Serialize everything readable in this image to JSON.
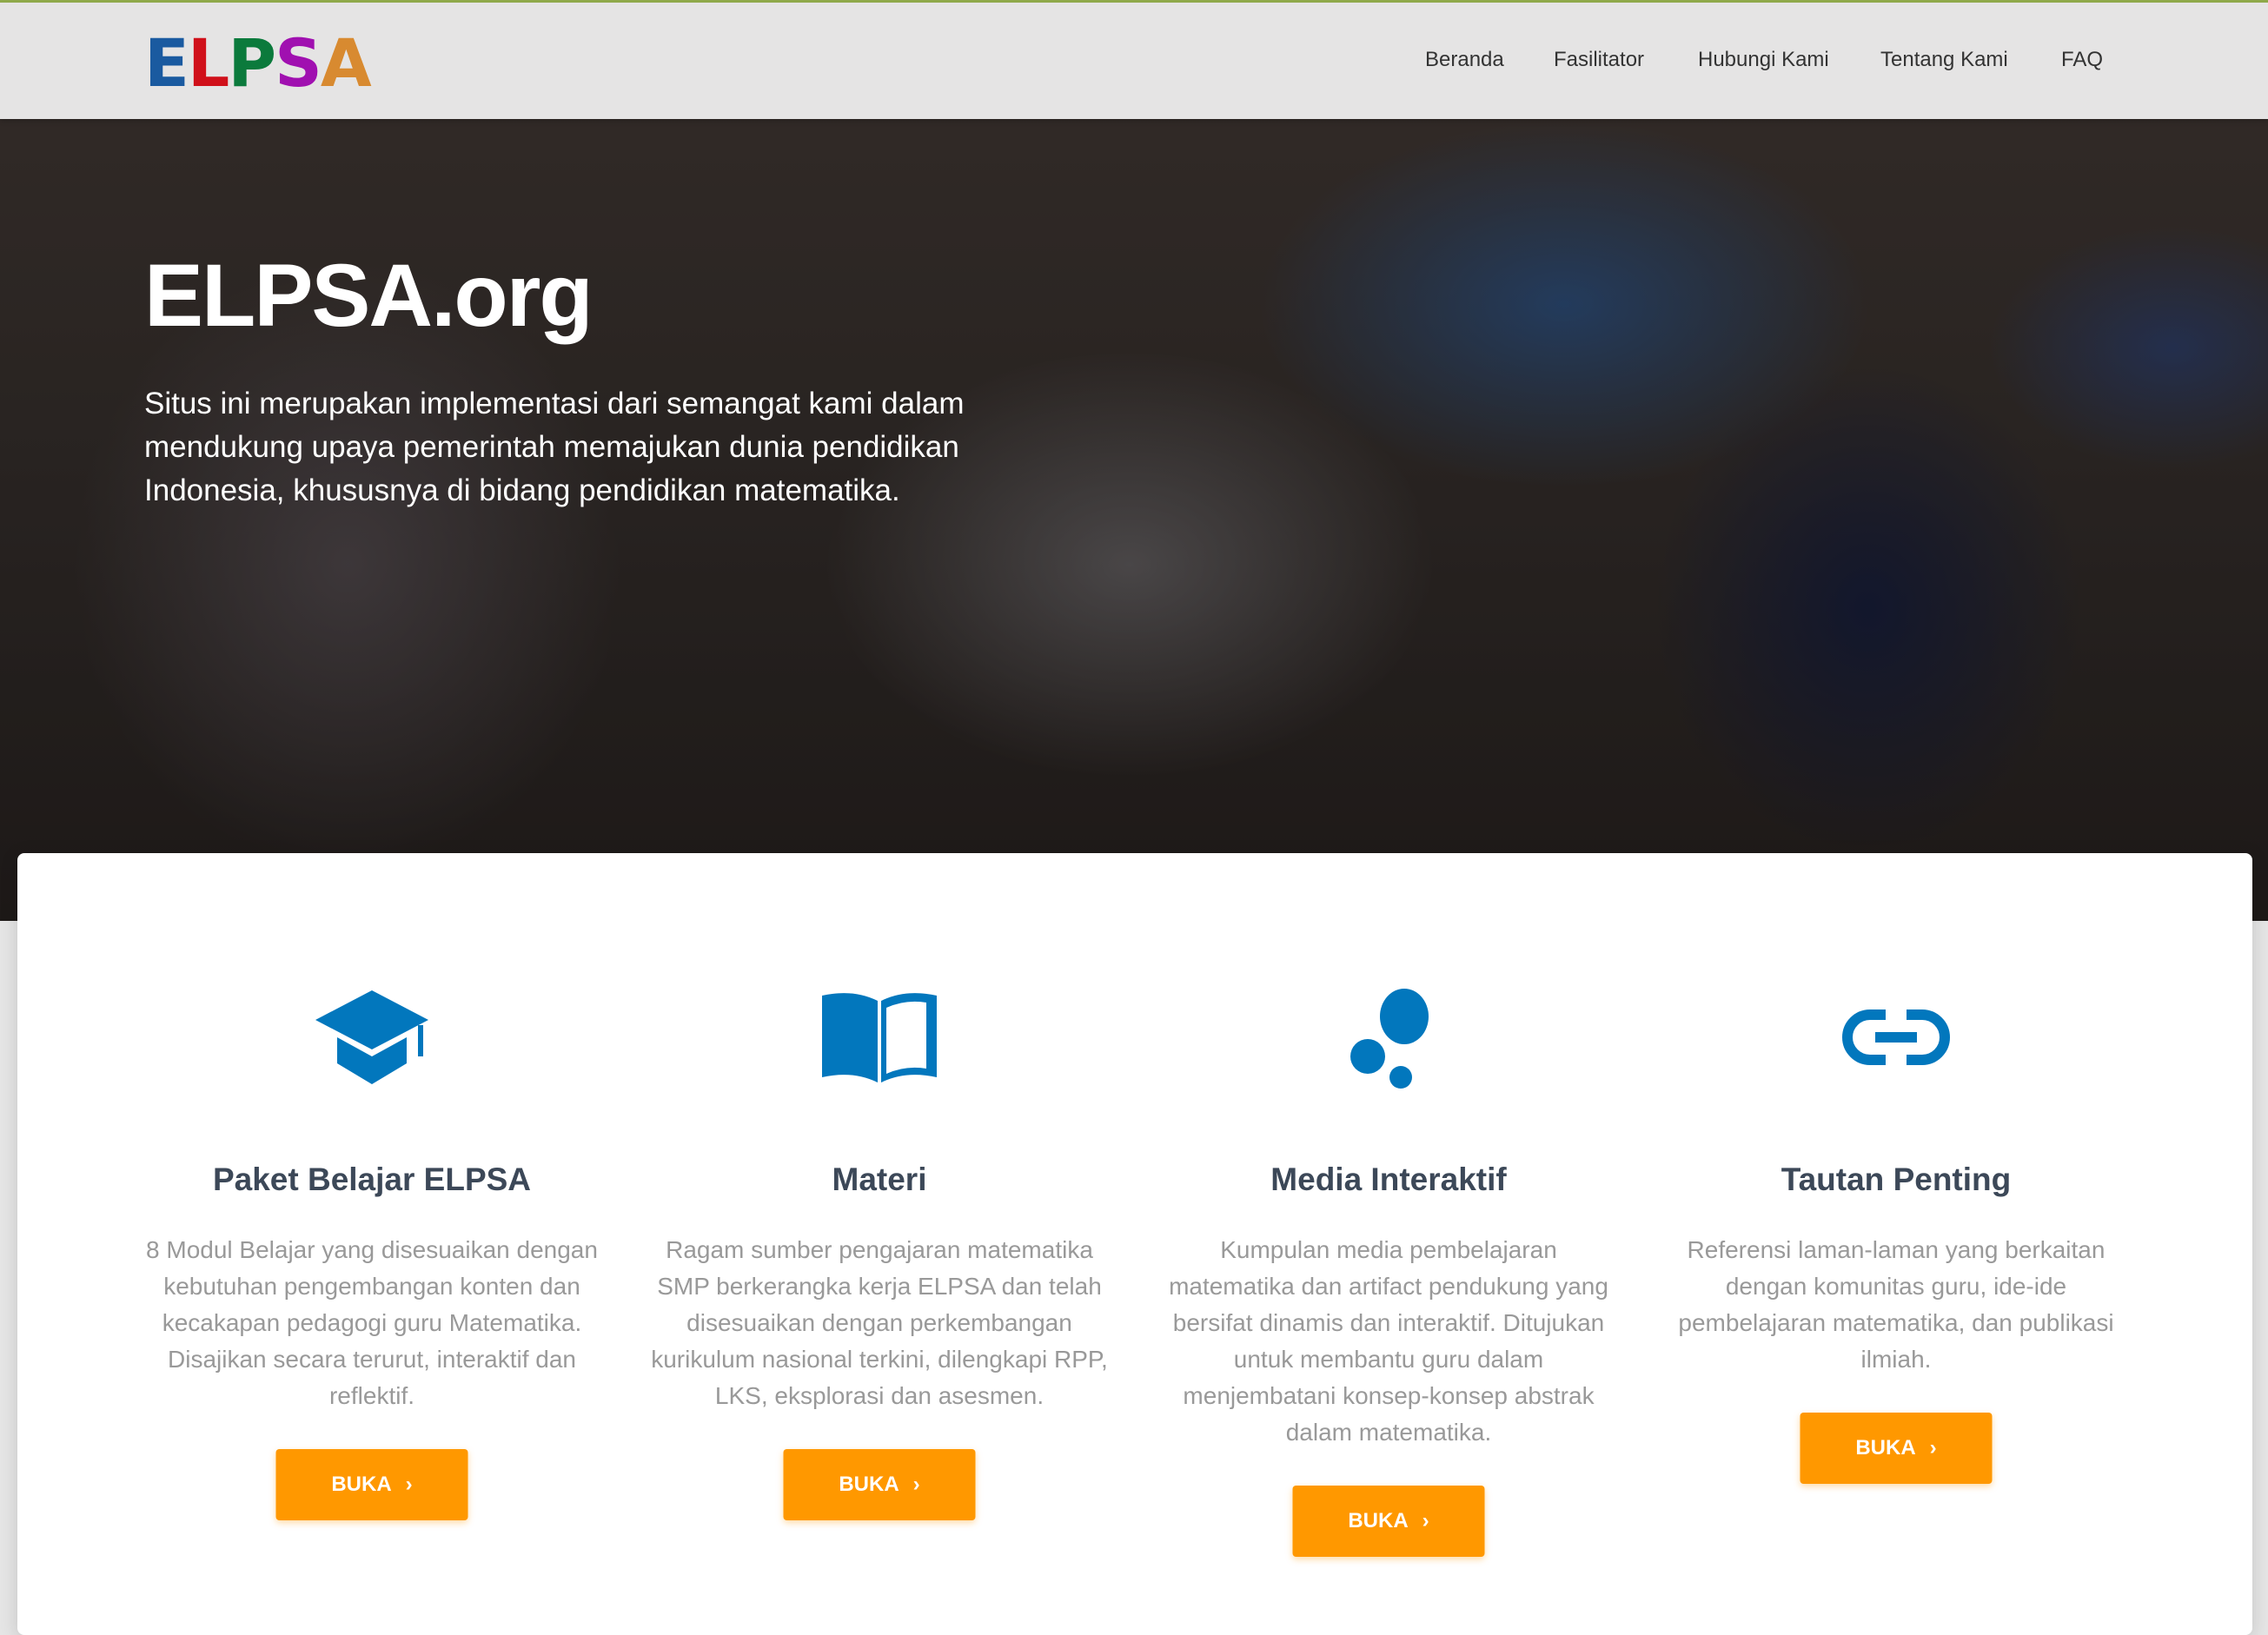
{
  "nav": {
    "logo": "ELPSA",
    "items": [
      "Beranda",
      "Fasilitator",
      "Hubungi Kami",
      "Tentang Kami",
      "FAQ"
    ]
  },
  "hero": {
    "title": "ELPSA.org",
    "description": "Situs ini merupakan implementasi dari semangat kami dalam mendukung upaya pemerintah memajukan dunia pendidikan Indonesia, khususnya di bidang pendidikan matematika."
  },
  "colors": {
    "accent": "#ff9800",
    "icon": "#0277bd",
    "heading": "#3c4858"
  },
  "features": [
    {
      "icon": "graduation-cap-icon",
      "title": "Paket Belajar ELPSA",
      "description": "8 Modul Belajar yang disesuaikan dengan kebutuhan pengembangan konten dan kecakapan pedagogi guru Matematika. Disajikan secara terurut, interaktif dan reflektif.",
      "button": "BUKA"
    },
    {
      "icon": "book-open-icon",
      "title": "Materi",
      "description": "Ragam sumber pengajaran matematika SMP berkerangka kerja ELPSA dan telah disesuaikan dengan perkembangan kurikulum nasional terkini, dilengkapi RPP, LKS, eksplorasi dan asesmen.",
      "button": "BUKA"
    },
    {
      "icon": "bubbles-icon",
      "title": "Media Interaktif",
      "description": "Kumpulan media pembelajaran matematika dan artifact pendukung yang bersifat dinamis dan interaktif. Ditujukan untuk membantu guru dalam menjembatani konsep-konsep abstrak dalam matematika.",
      "button": "BUKA"
    },
    {
      "icon": "link-icon",
      "title": "Tautan Penting",
      "description": "Referensi laman-laman yang berkaitan dengan komunitas guru, ide-ide pembelajaran matematika, dan publikasi ilmiah.",
      "button": "BUKA"
    }
  ]
}
